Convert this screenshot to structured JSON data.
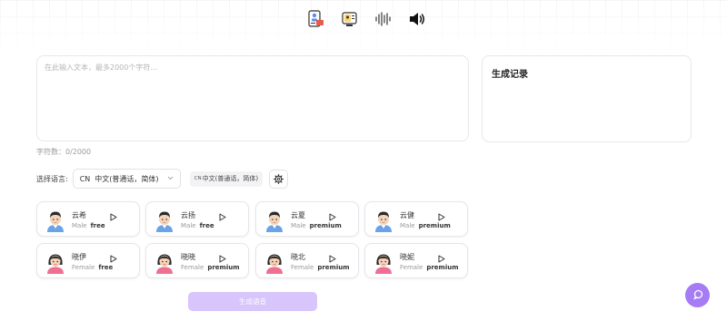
{
  "toolbar": {
    "icons": [
      "text-to-speech-icon",
      "image-to-speech-icon",
      "waveform-icon",
      "speaker-icon"
    ]
  },
  "editor": {
    "placeholder": "在此输入文本，最多2000个字符...",
    "char_count": "字符数：0/2000"
  },
  "history": {
    "title": "生成记录"
  },
  "language": {
    "label": "选择语言:",
    "code": "CN",
    "selected": "中文(普通话，简体)",
    "tag_code": "CN",
    "tag_label": "中文(普通话，简体)"
  },
  "voices": [
    {
      "name": "云希",
      "gender": "Male",
      "tier": "free",
      "avatar": "male"
    },
    {
      "name": "云扬",
      "gender": "Male",
      "tier": "free",
      "avatar": "male"
    },
    {
      "name": "云夏",
      "gender": "Male",
      "tier": "premium",
      "avatar": "male"
    },
    {
      "name": "云健",
      "gender": "Male",
      "tier": "premium",
      "avatar": "male"
    },
    {
      "name": "晓伊",
      "gender": "Female",
      "tier": "free",
      "avatar": "female"
    },
    {
      "name": "晓晓",
      "gender": "Female",
      "tier": "premium",
      "avatar": "female"
    },
    {
      "name": "晓北",
      "gender": "Female",
      "tier": "premium",
      "avatar": "female"
    },
    {
      "name": "晓妮",
      "gender": "Female",
      "tier": "premium",
      "avatar": "female"
    }
  ],
  "actions": {
    "generate_label": "生成语音"
  },
  "colors": {
    "accent": "#a57cf5",
    "button_disabled": "#d7c5fb"
  }
}
